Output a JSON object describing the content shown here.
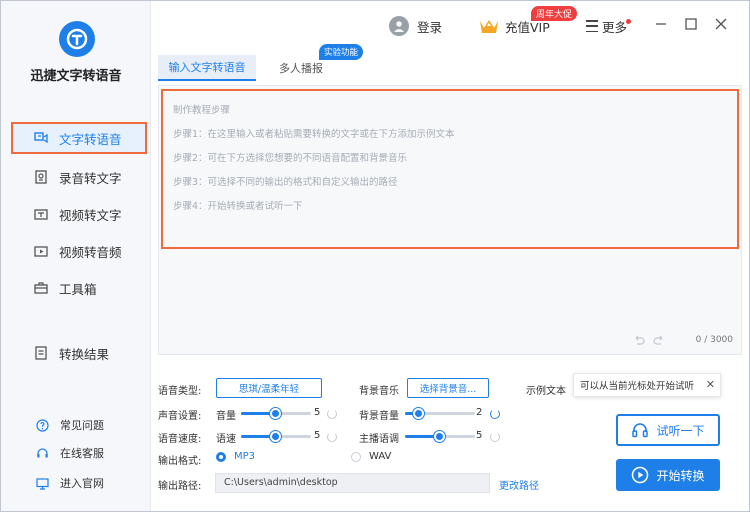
{
  "app": {
    "brand": "迅捷文字转语音",
    "accent_color": "#1f7fe8",
    "highlight_color": "#ef6a3c"
  },
  "topbar": {
    "login": "登录",
    "vip": "充值VIP",
    "promo": "周年大促",
    "more": "更多"
  },
  "sidebar": {
    "items": [
      {
        "label": "文字转语音",
        "icon": "text-to-speech-icon",
        "active": true
      },
      {
        "label": "录音转文字",
        "icon": "recording-icon",
        "active": false
      },
      {
        "label": "视频转文字",
        "icon": "video-text-icon",
        "active": false
      },
      {
        "label": "视频转音频",
        "icon": "video-audio-icon",
        "active": false
      },
      {
        "label": "工具箱",
        "icon": "toolbox-icon",
        "active": false
      },
      {
        "label": "转换结果",
        "icon": "result-icon",
        "active": false
      }
    ],
    "bottom": [
      {
        "label": "常见问题",
        "icon": "question-icon"
      },
      {
        "label": "在线客服",
        "icon": "headset-icon"
      },
      {
        "label": "进入官网",
        "icon": "monitor-icon"
      }
    ]
  },
  "tabs": [
    {
      "label": "输入文字转语音",
      "active": true
    },
    {
      "label": "多人播报",
      "active": false
    }
  ],
  "lab_badge": "实验功能",
  "editor": {
    "guide": [
      "制作教程步骤",
      "步骤1：在这里输入或者粘贴需要转换的文字或在下方添加示例文本",
      "步骤2：可在下方选择您想要的不同语音配置和背景音乐",
      "步骤3：可选择不同的输出的格式和自定义输出的路径",
      "步骤4：开始转换或者试听一下"
    ],
    "count": "0 / 3000"
  },
  "settings": {
    "voice_type_label": "语音类型:",
    "voice_type_value": "思琪/温柔年轻",
    "bg_music_label": "背景音乐",
    "bg_music_button": "选择背景音...",
    "sample_text_label": "示例文本",
    "sound_label": "声音设置:",
    "volume_label": "音量",
    "volume_value": "5",
    "volume_fraction": 0.5,
    "bg_volume_label": "背景音量",
    "bg_volume_value": "2",
    "bg_volume_fraction": 0.2,
    "speed_section_label": "语音速度:",
    "speed_label": "语速",
    "speed_value": "5",
    "speed_fraction": 0.5,
    "pitch_label": "主播语调",
    "pitch_value": "5",
    "pitch_fraction": 0.5,
    "format_label": "输出格式:",
    "format_mp3": "MP3",
    "format_wav": "WAV",
    "path_label": "输出路径:",
    "path_value": "C:\\Users\\admin\\desktop",
    "change_path": "更改路径"
  },
  "tooltip": {
    "text": "可以从当前光标处开始试听"
  },
  "buttons": {
    "listen": "试听一下",
    "convert": "开始转换"
  }
}
